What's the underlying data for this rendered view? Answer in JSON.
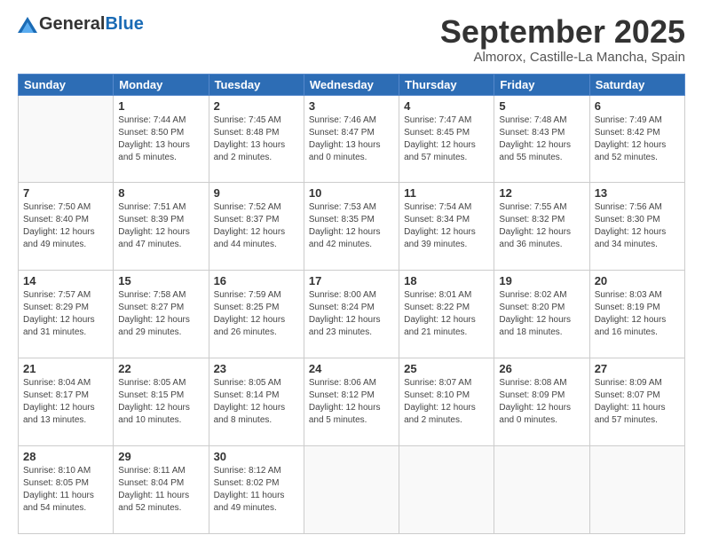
{
  "logo": {
    "text_general": "General",
    "text_blue": "Blue"
  },
  "header": {
    "month_title": "September 2025",
    "location": "Almorox, Castille-La Mancha, Spain"
  },
  "weekdays": [
    "Sunday",
    "Monday",
    "Tuesday",
    "Wednesday",
    "Thursday",
    "Friday",
    "Saturday"
  ],
  "weeks": [
    [
      {
        "day": "",
        "info": ""
      },
      {
        "day": "1",
        "info": "Sunrise: 7:44 AM\nSunset: 8:50 PM\nDaylight: 13 hours\nand 5 minutes."
      },
      {
        "day": "2",
        "info": "Sunrise: 7:45 AM\nSunset: 8:48 PM\nDaylight: 13 hours\nand 2 minutes."
      },
      {
        "day": "3",
        "info": "Sunrise: 7:46 AM\nSunset: 8:47 PM\nDaylight: 13 hours\nand 0 minutes."
      },
      {
        "day": "4",
        "info": "Sunrise: 7:47 AM\nSunset: 8:45 PM\nDaylight: 12 hours\nand 57 minutes."
      },
      {
        "day": "5",
        "info": "Sunrise: 7:48 AM\nSunset: 8:43 PM\nDaylight: 12 hours\nand 55 minutes."
      },
      {
        "day": "6",
        "info": "Sunrise: 7:49 AM\nSunset: 8:42 PM\nDaylight: 12 hours\nand 52 minutes."
      }
    ],
    [
      {
        "day": "7",
        "info": "Sunrise: 7:50 AM\nSunset: 8:40 PM\nDaylight: 12 hours\nand 49 minutes."
      },
      {
        "day": "8",
        "info": "Sunrise: 7:51 AM\nSunset: 8:39 PM\nDaylight: 12 hours\nand 47 minutes."
      },
      {
        "day": "9",
        "info": "Sunrise: 7:52 AM\nSunset: 8:37 PM\nDaylight: 12 hours\nand 44 minutes."
      },
      {
        "day": "10",
        "info": "Sunrise: 7:53 AM\nSunset: 8:35 PM\nDaylight: 12 hours\nand 42 minutes."
      },
      {
        "day": "11",
        "info": "Sunrise: 7:54 AM\nSunset: 8:34 PM\nDaylight: 12 hours\nand 39 minutes."
      },
      {
        "day": "12",
        "info": "Sunrise: 7:55 AM\nSunset: 8:32 PM\nDaylight: 12 hours\nand 36 minutes."
      },
      {
        "day": "13",
        "info": "Sunrise: 7:56 AM\nSunset: 8:30 PM\nDaylight: 12 hours\nand 34 minutes."
      }
    ],
    [
      {
        "day": "14",
        "info": "Sunrise: 7:57 AM\nSunset: 8:29 PM\nDaylight: 12 hours\nand 31 minutes."
      },
      {
        "day": "15",
        "info": "Sunrise: 7:58 AM\nSunset: 8:27 PM\nDaylight: 12 hours\nand 29 minutes."
      },
      {
        "day": "16",
        "info": "Sunrise: 7:59 AM\nSunset: 8:25 PM\nDaylight: 12 hours\nand 26 minutes."
      },
      {
        "day": "17",
        "info": "Sunrise: 8:00 AM\nSunset: 8:24 PM\nDaylight: 12 hours\nand 23 minutes."
      },
      {
        "day": "18",
        "info": "Sunrise: 8:01 AM\nSunset: 8:22 PM\nDaylight: 12 hours\nand 21 minutes."
      },
      {
        "day": "19",
        "info": "Sunrise: 8:02 AM\nSunset: 8:20 PM\nDaylight: 12 hours\nand 18 minutes."
      },
      {
        "day": "20",
        "info": "Sunrise: 8:03 AM\nSunset: 8:19 PM\nDaylight: 12 hours\nand 16 minutes."
      }
    ],
    [
      {
        "day": "21",
        "info": "Sunrise: 8:04 AM\nSunset: 8:17 PM\nDaylight: 12 hours\nand 13 minutes."
      },
      {
        "day": "22",
        "info": "Sunrise: 8:05 AM\nSunset: 8:15 PM\nDaylight: 12 hours\nand 10 minutes."
      },
      {
        "day": "23",
        "info": "Sunrise: 8:05 AM\nSunset: 8:14 PM\nDaylight: 12 hours\nand 8 minutes."
      },
      {
        "day": "24",
        "info": "Sunrise: 8:06 AM\nSunset: 8:12 PM\nDaylight: 12 hours\nand 5 minutes."
      },
      {
        "day": "25",
        "info": "Sunrise: 8:07 AM\nSunset: 8:10 PM\nDaylight: 12 hours\nand 2 minutes."
      },
      {
        "day": "26",
        "info": "Sunrise: 8:08 AM\nSunset: 8:09 PM\nDaylight: 12 hours\nand 0 minutes."
      },
      {
        "day": "27",
        "info": "Sunrise: 8:09 AM\nSunset: 8:07 PM\nDaylight: 11 hours\nand 57 minutes."
      }
    ],
    [
      {
        "day": "28",
        "info": "Sunrise: 8:10 AM\nSunset: 8:05 PM\nDaylight: 11 hours\nand 54 minutes."
      },
      {
        "day": "29",
        "info": "Sunrise: 8:11 AM\nSunset: 8:04 PM\nDaylight: 11 hours\nand 52 minutes."
      },
      {
        "day": "30",
        "info": "Sunrise: 8:12 AM\nSunset: 8:02 PM\nDaylight: 11 hours\nand 49 minutes."
      },
      {
        "day": "",
        "info": ""
      },
      {
        "day": "",
        "info": ""
      },
      {
        "day": "",
        "info": ""
      },
      {
        "day": "",
        "info": ""
      }
    ]
  ]
}
